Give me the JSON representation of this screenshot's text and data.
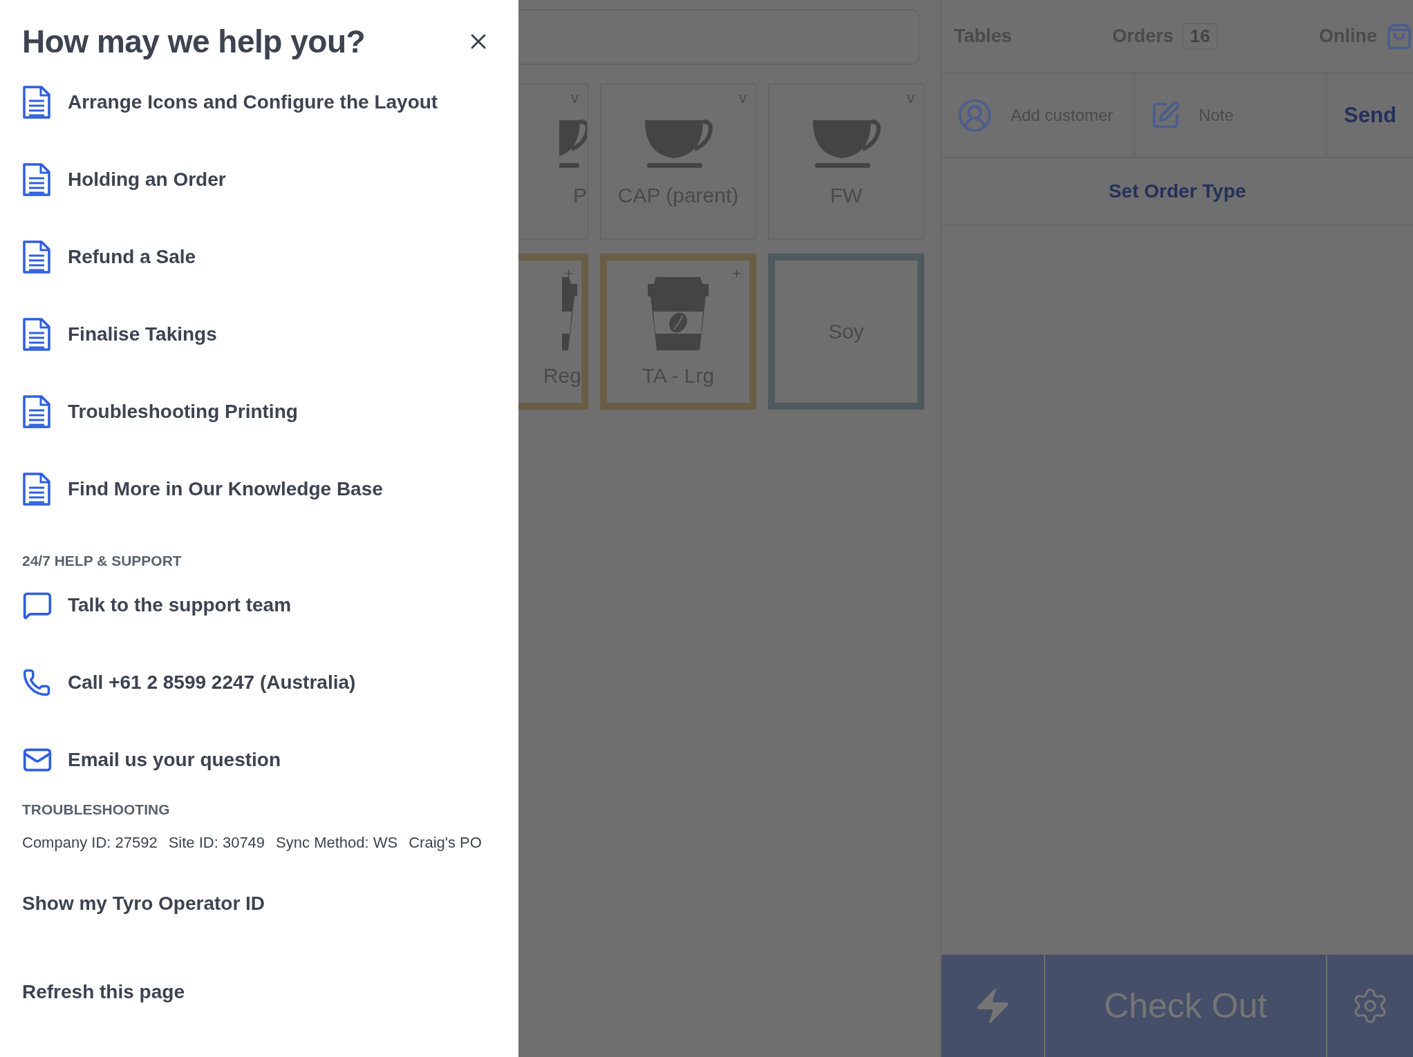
{
  "help_panel": {
    "title": "How may we help you?",
    "articles": [
      {
        "label": "Arrange Icons and Configure the Layout"
      },
      {
        "label": "Holding an Order"
      },
      {
        "label": "Refund a Sale"
      },
      {
        "label": "Finalise Takings"
      },
      {
        "label": "Troubleshooting Printing"
      },
      {
        "label": "Find More in Our Knowledge Base"
      }
    ],
    "support_heading": "24/7 HELP & SUPPORT",
    "support": [
      {
        "kind": "chat",
        "label": "Talk to the support team"
      },
      {
        "kind": "phone",
        "label": "Call +61 2 8599 2247 (Australia)"
      },
      {
        "kind": "email",
        "label": "Email us your question"
      }
    ],
    "troubleshooting_heading": "TROUBLESHOOTING",
    "troubleshooting_info": [
      "Company ID: 27592",
      "Site ID: 30749",
      "Sync Method: WS",
      "Craig's PO"
    ],
    "actions": [
      "Show my Tyro Operator ID",
      "Refresh this page"
    ]
  },
  "products": [
    {
      "label": "P",
      "kind": "cup",
      "corner": "v",
      "partial": true
    },
    {
      "label": "CAP (parent)",
      "kind": "cup",
      "corner": "v",
      "partial": false
    },
    {
      "label": "FW",
      "kind": "cup",
      "corner": "v",
      "partial": false
    },
    {
      "label": "Reg",
      "kind": "takeaway",
      "corner": "+",
      "partial": true,
      "color": "#6b5e47"
    },
    {
      "label": "TA - Lrg",
      "kind": "takeaway",
      "corner": "+",
      "partial": false,
      "color": "#6b5e47"
    },
    {
      "label": "Soy",
      "kind": "text",
      "partial": false,
      "color": "#4f5a5e"
    }
  ],
  "order_panel": {
    "tabs": [
      {
        "label": "Tables"
      },
      {
        "label": "Orders",
        "count": "16"
      },
      {
        "label": "Online"
      }
    ],
    "add_customer": "Add customer",
    "note": "Note",
    "send": "Send",
    "order_type": "Set Order Type",
    "checkout": "Check Out"
  }
}
